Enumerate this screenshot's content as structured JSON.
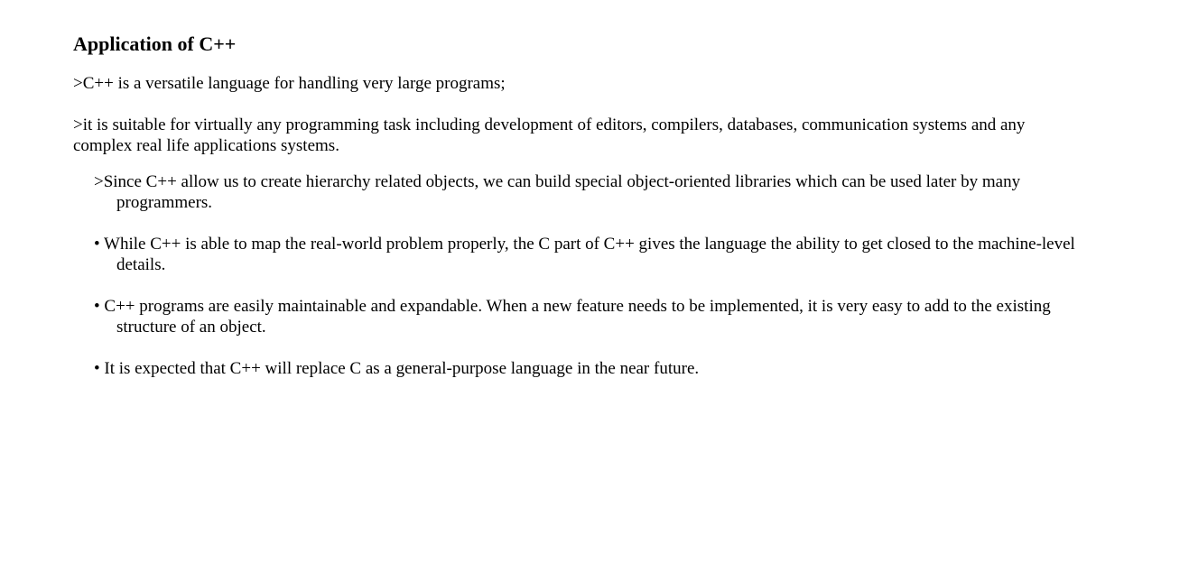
{
  "title": "Application of C++",
  "paragraphs": [
    ">C++ is a versatile language for handling very large programs;",
    ">it is suitable for virtually any programming task including development of editors, compilers, databases, communication systems and any complex real life applications systems."
  ],
  "items": [
    ">Since C++ allow us to create hierarchy related objects, we can build special object-oriented libraries which can be used later by many programmers.",
    "• While C++ is able to map the real-world problem properly, the C part of C++ gives the language the ability to get closed to the machine-level details.",
    "• C++ programs are easily maintainable and expandable. When a new feature needs to be implemented, it is very easy to add to the existing structure of an object.",
    "• It is expected that C++ will replace C as a general-purpose language in the near future."
  ]
}
